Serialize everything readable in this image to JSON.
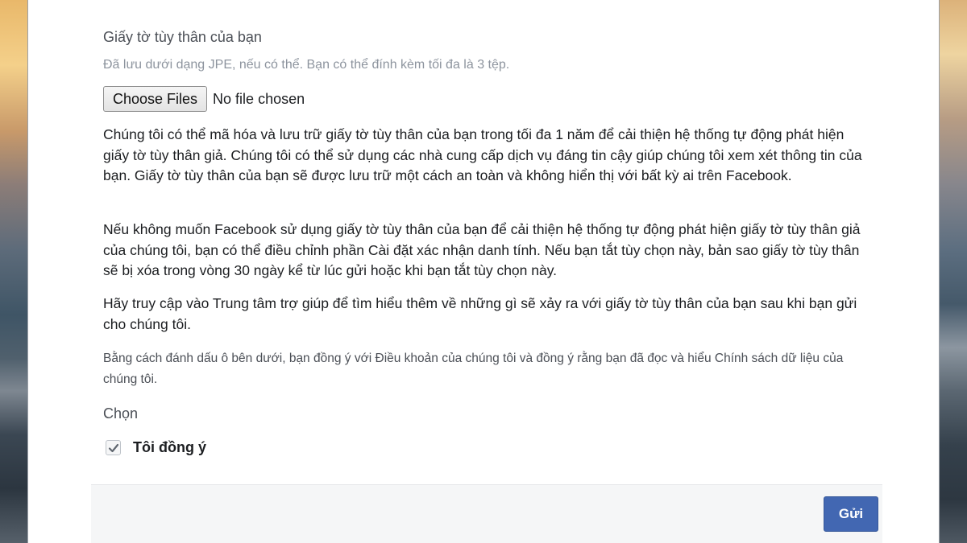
{
  "id_section": {
    "title": "Giấy tờ tùy thân của bạn",
    "description": "Đã lưu dưới dạng JPE, nếu có thể. Bạn có thể đính kèm tối đa là 3 tệp."
  },
  "file_input": {
    "button_label": "Choose Files",
    "status": "No file chosen"
  },
  "paragraphs": {
    "p1": "Chúng tôi có thể mã hóa và lưu trữ giấy tờ tùy thân của bạn trong tối đa 1 năm để cải thiện hệ thống tự động phát hiện giấy tờ tùy thân giả. Chúng tôi có thể sử dụng các nhà cung cấp dịch vụ đáng tin cậy giúp chúng tôi xem xét thông tin của bạn. Giấy tờ tùy thân của bạn sẽ được lưu trữ một cách an toàn và không hiển thị với bất kỳ ai trên Facebook.",
    "p2": "Nếu không muốn Facebook sử dụng giấy tờ tùy thân của bạn để cải thiện hệ thống tự động phát hiện giấy tờ tùy thân giả của chúng tôi, bạn có thể điều chỉnh phần Cài đặt xác nhận danh tính. Nếu bạn tắt tùy chọn này, bản sao giấy tờ tùy thân sẽ bị xóa trong vòng 30 ngày kể từ lúc gửi hoặc khi bạn tắt tùy chọn này.",
    "p3": "Hãy truy cập vào Trung tâm trợ giúp để tìm hiểu thêm về những gì sẽ xảy ra với giấy tờ tùy thân của bạn sau khi bạn gửi cho chúng tôi.",
    "p4": "Bằng cách đánh dấu ô bên dưới, bạn đồng ý với Điều khoản của chúng tôi và đồng ý rằng bạn đã đọc và hiểu Chính sách dữ liệu của chúng tôi."
  },
  "consent": {
    "label": "Chọn",
    "checkbox_label": "Tôi đồng ý",
    "checked": true
  },
  "footer": {
    "submit_label": "Gửi"
  },
  "colors": {
    "primary_button": "#4267b2",
    "text": "#1c1e21",
    "secondary_text": "#8d949e"
  },
  "icons": {
    "checkmark": "check-icon"
  }
}
